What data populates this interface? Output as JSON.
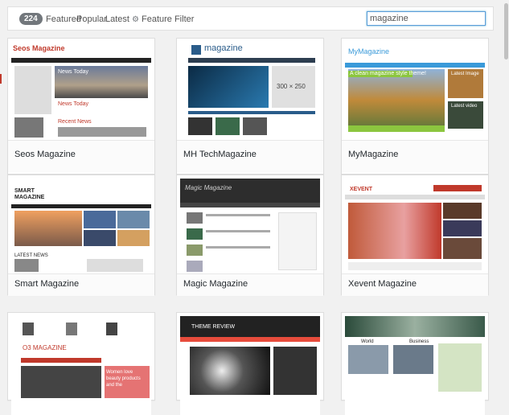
{
  "filter_bar": {
    "count": "224",
    "tabs": [
      "Featured",
      "Popular",
      "Latest"
    ],
    "feature_filter": "Feature Filter",
    "search_value": "magazine"
  },
  "themes": [
    {
      "name": "Seos Magazine",
      "thumb_title": "Seos Magazine",
      "thumb_texts": [
        "News Today",
        "News Today",
        "Recent News"
      ]
    },
    {
      "name": "MH TechMagazine",
      "thumb_title": "magazine",
      "thumb_texts": [
        "300 × 250"
      ]
    },
    {
      "name": "MyMagazine",
      "thumb_title": "MyMagazine",
      "thumb_texts": [
        "A clean magazine style theme!",
        "Latest Image",
        "Latest video"
      ]
    },
    {
      "name": "Smart Magazine",
      "thumb_title": "SMART MAGAZINE",
      "thumb_texts": [
        "LATEST NEWS"
      ]
    },
    {
      "name": "Magic Magazine",
      "thumb_title": "Magic Magazine",
      "thumb_texts": []
    },
    {
      "name": "Xevent Magazine",
      "thumb_title": "XEVENT",
      "thumb_texts": []
    },
    {
      "name": "",
      "thumb_title": "O3 MAGAZINE",
      "thumb_texts": [
        "Women love beauty products and the"
      ]
    },
    {
      "name": "",
      "thumb_title": "THEME REVIEW",
      "thumb_texts": []
    },
    {
      "name": "",
      "thumb_title": "",
      "thumb_texts": [
        "World",
        "Business"
      ]
    }
  ],
  "colors": {
    "accent": "#0073aa",
    "count_badge": "#72777c"
  }
}
